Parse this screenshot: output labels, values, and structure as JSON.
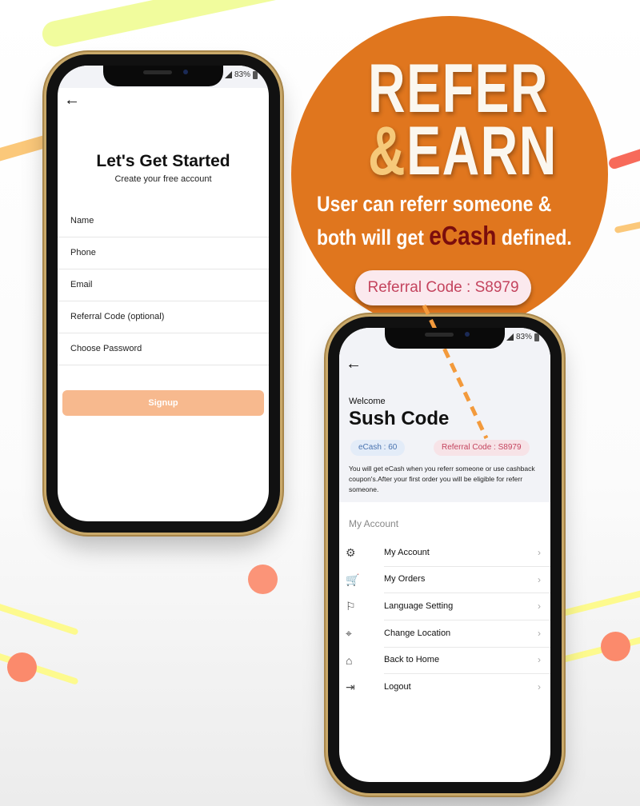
{
  "banner": {
    "headline_line1": "REFER",
    "headline_amp": "&",
    "headline_line2": "EARN",
    "tagline_line1": "User can referr someone &",
    "tagline_line2_pre": "both will get ",
    "tagline_line2_highlight": "eCash",
    "tagline_line2_post": " defined.",
    "referral_pill": "Referral Code : S8979",
    "colors": {
      "circle": "#e0761e",
      "highlight": "#7a0d0d",
      "pill_text": "#c4445e"
    }
  },
  "signup_screen": {
    "status": {
      "battery": "83%"
    },
    "back_icon": "arrow-left-icon",
    "title": "Let's Get Started",
    "subtitle": "Create your free account",
    "fields": [
      {
        "placeholder": "Name"
      },
      {
        "placeholder": "Phone"
      },
      {
        "placeholder": "Email"
      },
      {
        "placeholder": "Referral Code (optional)"
      },
      {
        "placeholder": "Choose Password"
      }
    ],
    "signup_label": "Signup",
    "colors": {
      "signup_bg": "#f7b98e"
    }
  },
  "profile_screen": {
    "status": {
      "battery": "83%"
    },
    "back_icon": "arrow-left-icon",
    "welcome": "Welcome",
    "username": "Sush Code",
    "ecash_chip": "eCash : 60",
    "referral_chip": "Referral Code : S8979",
    "description": "You will get eCash when you referr someone or use cashback coupon's.After your first order you will be eligible for referr someone.",
    "section_title": "My Account",
    "menu": [
      {
        "label": "My Account",
        "icon": "gear-icon",
        "glyph": "⚙"
      },
      {
        "label": "My Orders",
        "icon": "cart-icon",
        "glyph": "🛒"
      },
      {
        "label": "Language Setting",
        "icon": "flag-icon",
        "glyph": "⚐"
      },
      {
        "label": "Change Location",
        "icon": "location-pin-icon",
        "glyph": "⌖"
      },
      {
        "label": "Back to Home",
        "icon": "home-icon",
        "glyph": "⌂"
      },
      {
        "label": "Logout",
        "icon": "logout-icon",
        "glyph": "⇥"
      }
    ]
  }
}
